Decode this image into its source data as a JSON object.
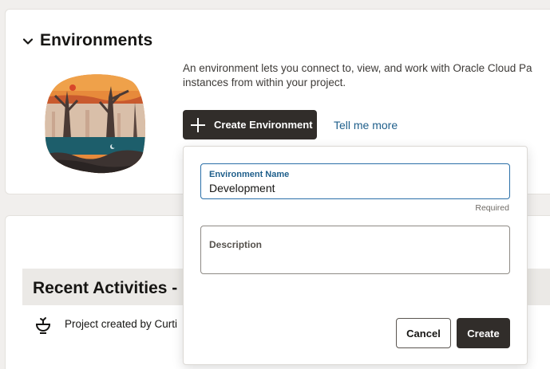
{
  "environments": {
    "title": "Environments",
    "description_line1": "An environment lets you connect to, view, and work with Oracle Cloud Pa",
    "description_line2": "instances from within your project.",
    "create_button_label": "Create Environment",
    "tell_me_more": "Tell me more"
  },
  "create_popup": {
    "name_label": "Environment Name",
    "name_value": "Development",
    "required_text": "Required",
    "description_label": "Description",
    "cancel_label": "Cancel",
    "create_label": "Create"
  },
  "activities": {
    "title": "Recent Activities -",
    "items": [
      {
        "text": "Project created by Curti"
      }
    ]
  },
  "icons": {
    "collapse": "chevron-down-icon",
    "add": "plus-icon",
    "activity": "project-created-icon"
  },
  "colors": {
    "primary_button": "#312d2a",
    "link": "#1f5f8b",
    "focus_border": "#2a6fa8"
  }
}
